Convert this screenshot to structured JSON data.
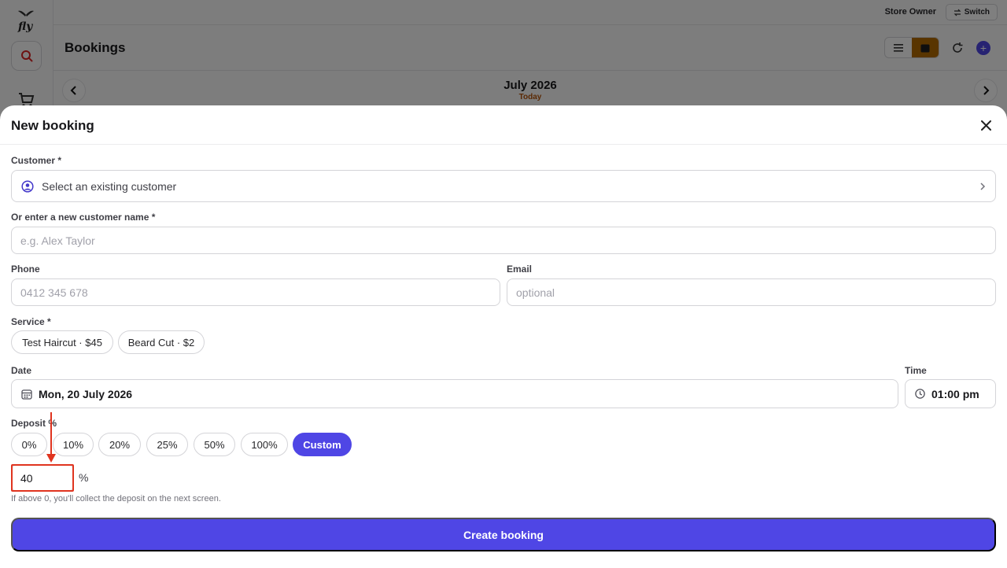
{
  "app": {
    "logo_text": "fly"
  },
  "topbar": {
    "role": "Store Owner",
    "switch_label": "Switch"
  },
  "page": {
    "title": "Bookings"
  },
  "calendar": {
    "month": "July 2026",
    "today_label": "Today"
  },
  "modal": {
    "title": "New booking",
    "customer_label": "Customer *",
    "customer_placeholder": "Select an existing customer",
    "new_name_label": "Or enter a new customer name *",
    "new_name_placeholder": "e.g. Alex Taylor",
    "phone_label": "Phone",
    "phone_placeholder": "0412 345 678",
    "email_label": "Email",
    "email_placeholder": "optional",
    "service_label": "Service *",
    "services": [
      "Test Haircut · $45",
      "Beard Cut · $2"
    ],
    "date_label": "Date",
    "date_value": "Mon, 20 July 2026",
    "time_label": "Time",
    "time_value": "01:00 pm",
    "deposit_label": "Deposit %",
    "deposit_options": [
      "0%",
      "10%",
      "20%",
      "25%",
      "50%",
      "100%",
      "Custom"
    ],
    "deposit_selected": "Custom",
    "custom_value": "40",
    "percent_symbol": "%",
    "hint": "If above 0, you'll collect the deposit on the next screen.",
    "submit_label": "Create booking"
  },
  "colors": {
    "primary": "#4f46e5",
    "accent_brown": "#b26b00",
    "annotation_red": "#e0341f"
  }
}
